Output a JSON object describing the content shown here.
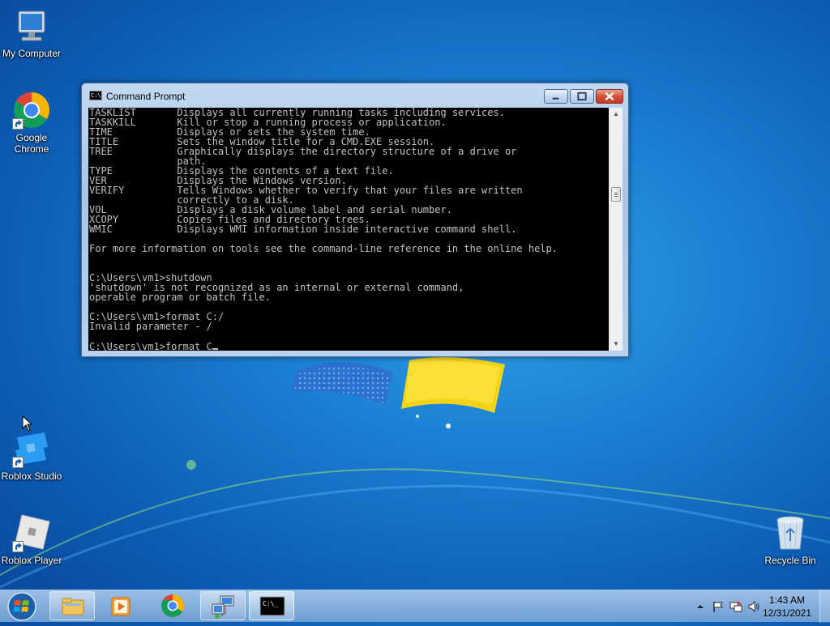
{
  "desktop": {
    "icons": [
      {
        "label": "My Computer"
      },
      {
        "label_line1": "Google",
        "label_line2": "Chrome"
      },
      {
        "label": "Roblox Studio"
      },
      {
        "label": "Roblox Player"
      },
      {
        "label": "Recycle Bin"
      }
    ]
  },
  "window": {
    "title": "Command Prompt",
    "console_lines": [
      "TASKLIST       Displays all currently running tasks including services.",
      "TASKKILL       Kill or stop a running process or application.",
      "TIME           Displays or sets the system time.",
      "TITLE          Sets the window title for a CMD.EXE session.",
      "TREE           Graphically displays the directory structure of a drive or",
      "               path.",
      "TYPE           Displays the contents of a text file.",
      "VER            Displays the Windows version.",
      "VERIFY         Tells Windows whether to verify that your files are written",
      "               correctly to a disk.",
      "VOL            Displays a disk volume label and serial number.",
      "XCOPY          Copies files and directory trees.",
      "WMIC           Displays WMI information inside interactive command shell.",
      "",
      "For more information on tools see the command-line reference in the online help.",
      "",
      "",
      "C:\\Users\\vm1>shutdown",
      "'shutdown' is not recognized as an internal or external command,",
      "operable program or batch file.",
      "",
      "C:\\Users\\vm1>format C:/",
      "Invalid parameter - /",
      ""
    ],
    "prompt_line": "C:\\Users\\vm1>format C"
  },
  "taskbar": {
    "items": [
      {
        "icon": "windows-explorer-icon"
      },
      {
        "icon": "media-player-icon"
      },
      {
        "icon": "chrome-icon"
      },
      {
        "icon": "network-computer-icon"
      },
      {
        "icon": "command-prompt-icon",
        "icon_text": "C:\\_"
      }
    ],
    "clock_time": "1:43 AM",
    "clock_date": "12/31/2021"
  }
}
